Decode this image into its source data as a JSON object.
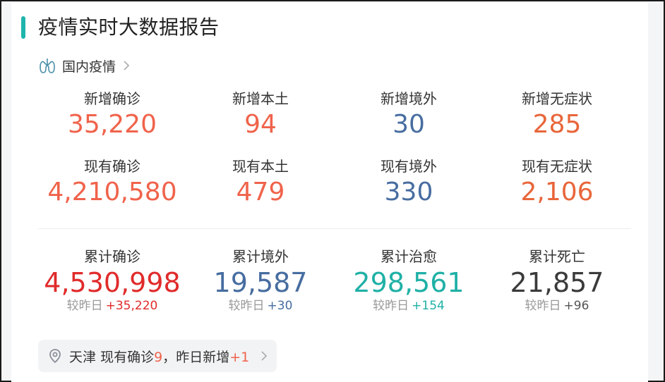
{
  "header": {
    "title": "疫情实时大数据报告"
  },
  "section": {
    "label": "国内疫情",
    "icon": "lung-icon"
  },
  "new_stats": [
    {
      "label": "新增确诊",
      "value": "35,220",
      "color": "#f0634b"
    },
    {
      "label": "新增本土",
      "value": "94",
      "color": "#f0634b"
    },
    {
      "label": "新增境外",
      "value": "30",
      "color": "#476da0"
    },
    {
      "label": "新增无症状",
      "value": "285",
      "color": "#e8663a"
    }
  ],
  "current_stats": [
    {
      "label": "现有确诊",
      "value": "4,210,580",
      "color": "#f0634b"
    },
    {
      "label": "现有本土",
      "value": "479",
      "color": "#f0634b"
    },
    {
      "label": "现有境外",
      "value": "330",
      "color": "#476da0"
    },
    {
      "label": "现有无症状",
      "value": "2,106",
      "color": "#e8663a"
    }
  ],
  "cumulative_stats": [
    {
      "label": "累计确诊",
      "value": "4,530,998",
      "diff_label": "较昨日",
      "diff": "+35,220",
      "color": "#e02b2b",
      "diff_color": "#e02b2b"
    },
    {
      "label": "累计境外",
      "value": "19,587",
      "diff_label": "较昨日",
      "diff": "+30",
      "color": "#476da0",
      "diff_color": "#476da0"
    },
    {
      "label": "累计治愈",
      "value": "298,561",
      "diff_label": "较昨日",
      "diff": "+154",
      "color": "#1fb0a6",
      "diff_color": "#1fb0a6"
    },
    {
      "label": "累计死亡",
      "value": "21,857",
      "diff_label": "较昨日",
      "diff": "+96",
      "color": "#3a3a3a",
      "diff_color": "#555555"
    }
  ],
  "tip": {
    "city": "天津",
    "current_label": "现有确诊",
    "current_value": "9",
    "sep": "，",
    "new_label": "昨日新增",
    "new_value": "+1",
    "icon": "location-pin-icon"
  }
}
